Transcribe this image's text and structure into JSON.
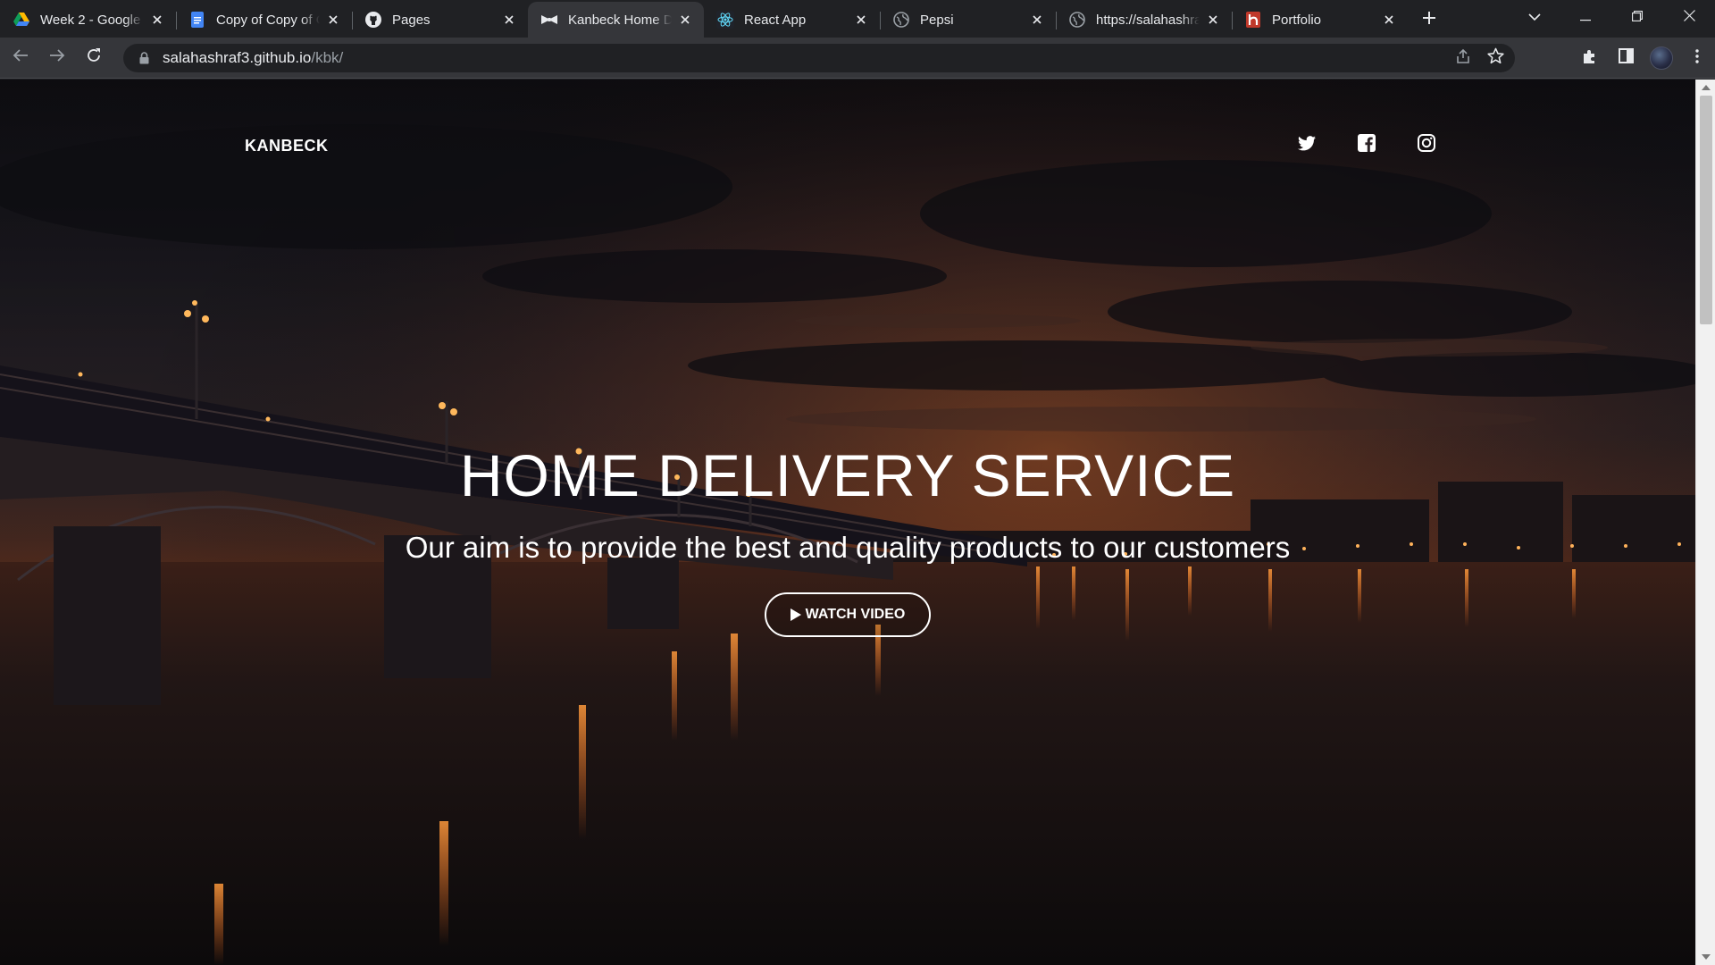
{
  "browser": {
    "tabs": [
      {
        "title": "Week 2 - Google",
        "icon": "google-drive-icon",
        "active": false
      },
      {
        "title": "Copy of Copy of C",
        "icon": "google-docs-icon",
        "active": false
      },
      {
        "title": "Pages",
        "icon": "github-icon",
        "active": false
      },
      {
        "title": "Kanbeck Home D",
        "icon": "bowtie-icon",
        "active": true
      },
      {
        "title": "React App",
        "icon": "react-icon",
        "active": false
      },
      {
        "title": "Pepsi",
        "icon": "globe-icon",
        "active": false
      },
      {
        "title": "https://salahashra",
        "icon": "globe-icon",
        "active": false
      },
      {
        "title": "Portfolio",
        "icon": "heroku-icon",
        "active": false
      }
    ],
    "address": {
      "host": "salahashraf3.github.io",
      "path": "/kbk/"
    }
  },
  "page": {
    "brand": "KANBECK",
    "social_icons": [
      "twitter-icon",
      "facebook-icon",
      "instagram-icon"
    ],
    "headline": "HOME DELIVERY SERVICE",
    "subheadline": "Our aim is to provide the best and quality products to our customers",
    "cta_label": "WATCH VIDEO"
  },
  "colors": {
    "chrome_dark": "#202124",
    "chrome_toolbar": "#35363a",
    "hero_text": "#ffffff",
    "sunset_orange": "#c4571e"
  }
}
